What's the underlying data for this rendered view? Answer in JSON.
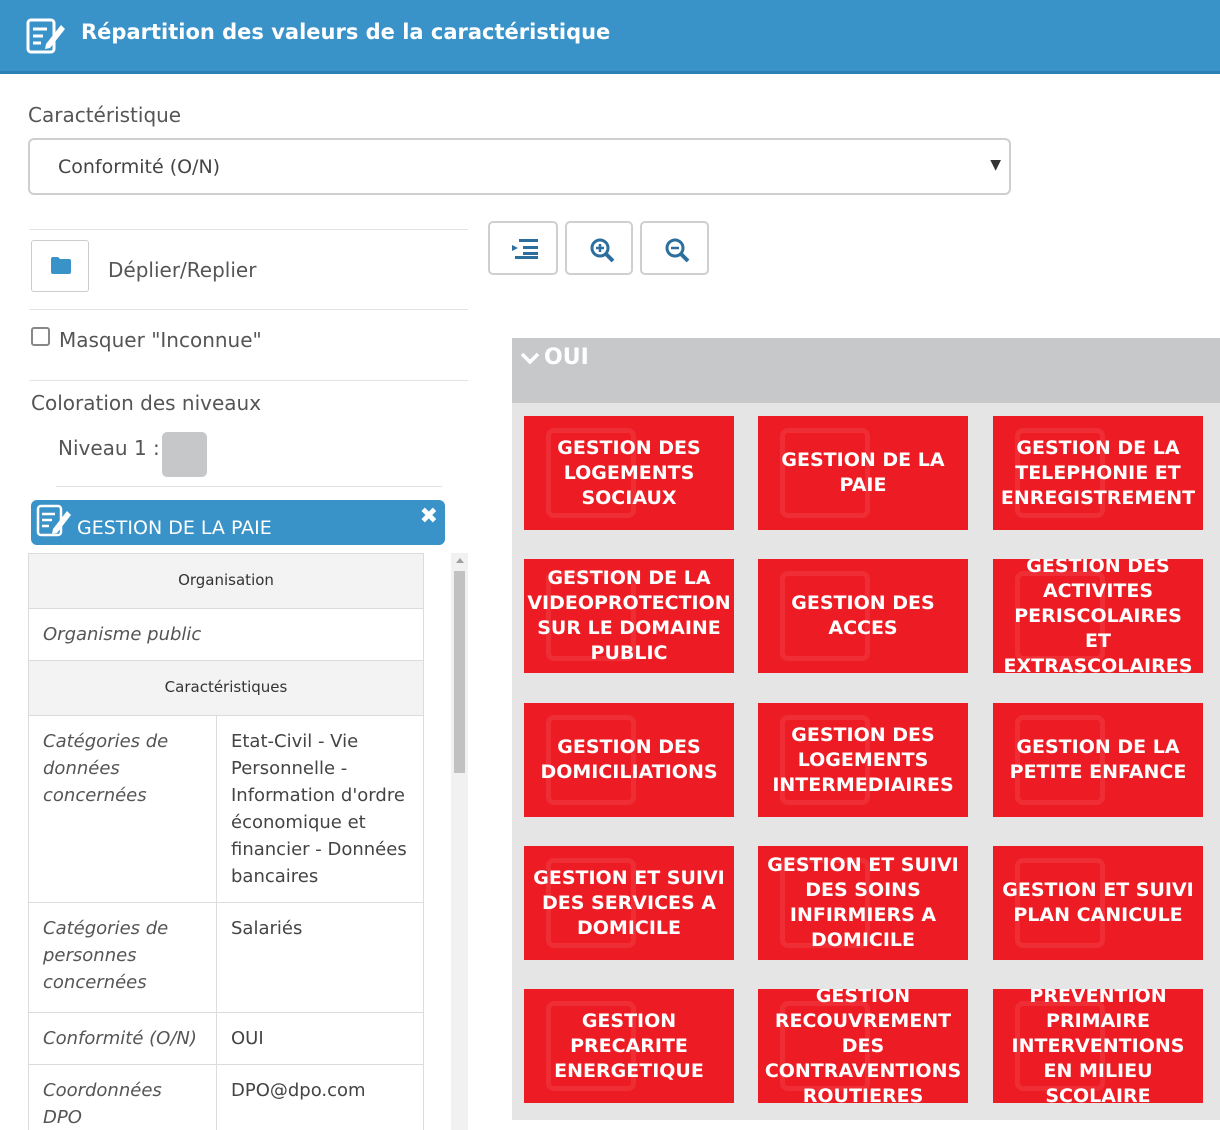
{
  "header": {
    "title": "Répartition des valeurs de la caractéristique",
    "icon": "edit-document-icon"
  },
  "characteristic": {
    "label": "Caractéristique",
    "selected": "Conformité (O/N)"
  },
  "left_panel": {
    "expand_label": "Déplier/Replier",
    "hide_unknown_label": "Masquer \"Inconnue\"",
    "hide_unknown_checked": false,
    "coloring_title": "Coloration des niveaux",
    "level1_label": "Niveau 1 :",
    "level1_color": "#c5c7c9"
  },
  "toolbar": {
    "icons": [
      "list-indent-icon",
      "zoom-in-icon",
      "zoom-out-icon"
    ]
  },
  "detail": {
    "title": "GESTION DE LA PAIE",
    "close_symbol": "✖",
    "organisation_header": "Organisation",
    "organisation_value": "Organisme public",
    "characteristics_header": "Caractéristiques",
    "rows": [
      {
        "key": "Catégories de données concernées",
        "value": "Etat-Civil - Vie Personnelle - Information d'ordre économique et financier - Données bancaires"
      },
      {
        "key": "Catégories de personnes concernées",
        "value": "Salariés"
      },
      {
        "key": "Conformité (O/N)",
        "value": "OUI"
      },
      {
        "key": "Coordonnées DPO",
        "value": "DPO@dpo.com"
      }
    ]
  },
  "group": {
    "title": "OUI",
    "tile_color": "#ed1c24",
    "tiles": [
      "GESTION DES LOGEMENTS SOCIAUX",
      "GESTION DE LA PAIE",
      "GESTION DE LA TELEPHONIE ET ENREGISTREMENT",
      "GESTION DE LA VIDEOPROTECTION SUR LE DOMAINE PUBLIC",
      "GESTION DES ACCES",
      "GESTION DES ACTIVITES PERISCOLAIRES ET EXTRASCOLAIRES",
      "GESTION DES DOMICILIATIONS",
      "GESTION DES LOGEMENTS INTERMEDIAIRES",
      "GESTION DE LA PETITE ENFANCE",
      "GESTION ET SUIVI DES SERVICES A DOMICILE",
      "GESTION ET SUIVI DES SOINS INFIRMIERS A DOMICILE",
      "GESTION ET SUIVI PLAN CANICULE",
      "GESTION PRECARITE ENERGETIQUE",
      "GESTION RECOUVREMENT DES CONTRAVENTIONS ROUTIERES",
      "PREVENTION PRIMAIRE INTERVENTIONS EN MILIEU SCOLAIRE"
    ]
  }
}
